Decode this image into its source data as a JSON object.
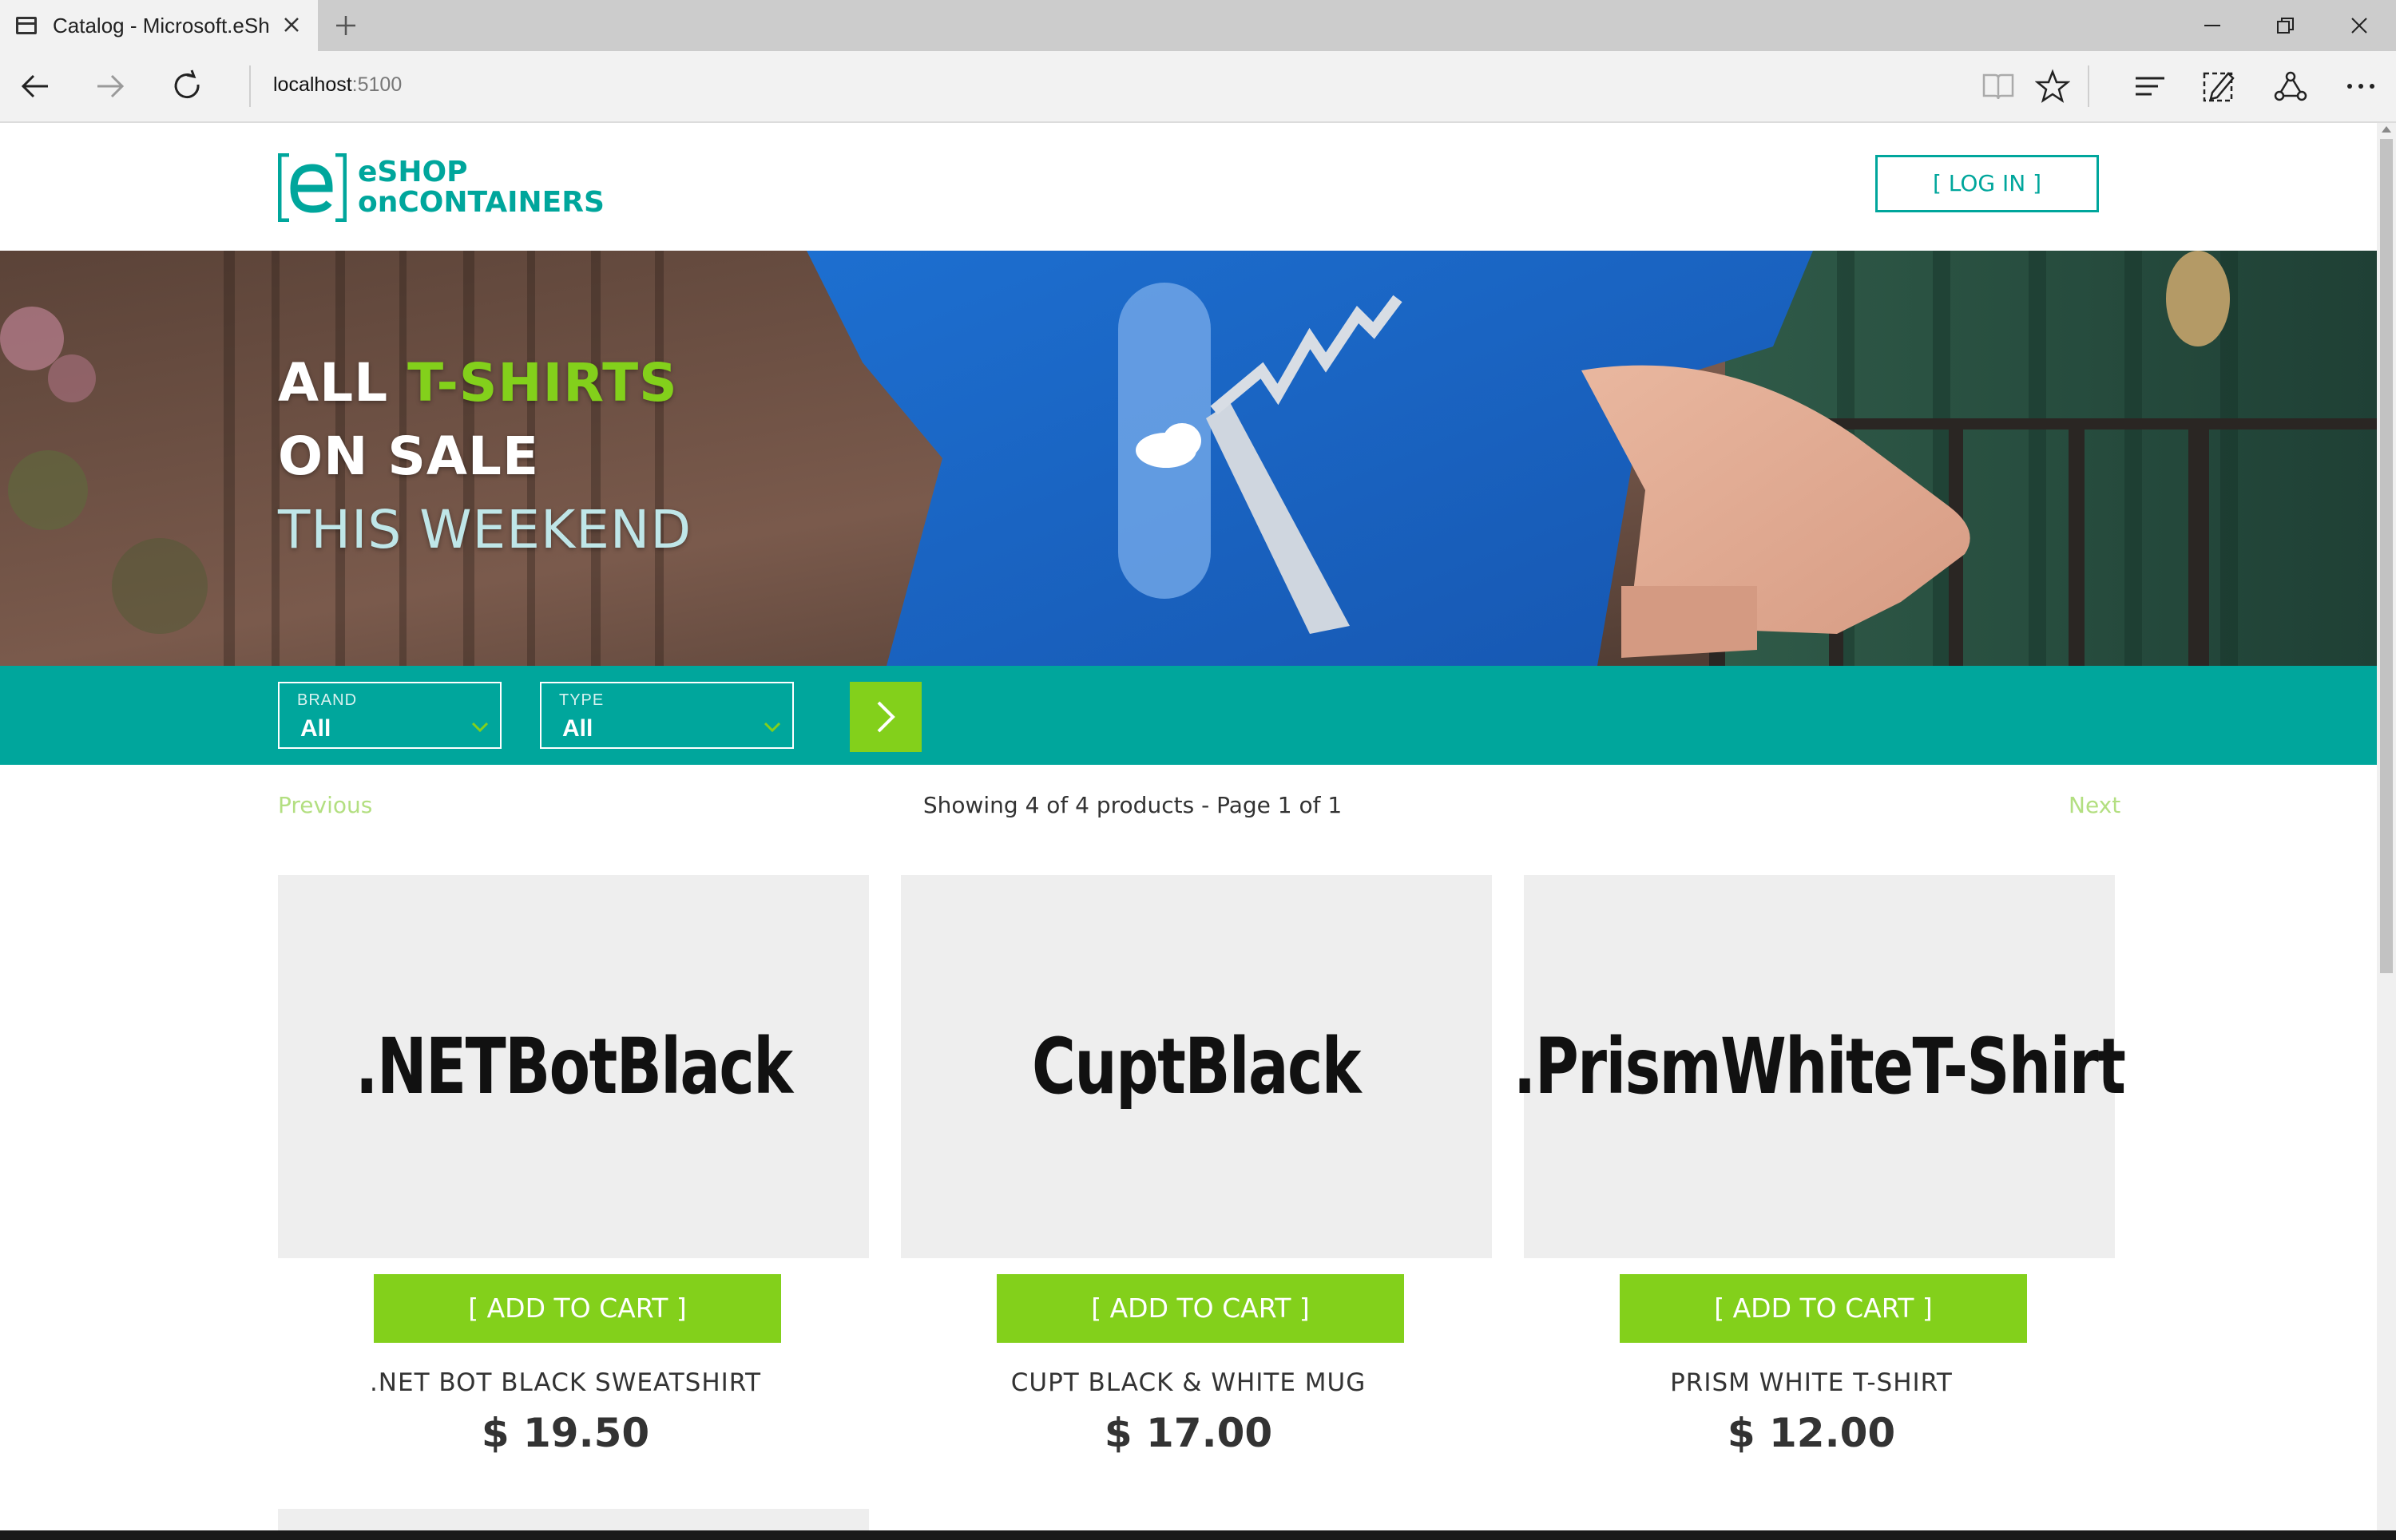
{
  "browser": {
    "tab_title": "Catalog - Microsoft.eSh",
    "address_host": "localhost",
    "address_port": ":5100"
  },
  "header": {
    "logo_line1": "eSHOP",
    "logo_line2": "onCONTAINERS",
    "login_label": "[ LOG IN ]"
  },
  "hero": {
    "line1_a": "ALL ",
    "line1_b": "T-SHIRTS",
    "line2": "ON SALE",
    "line3": "THIS WEEKEND"
  },
  "filters": {
    "brand_label": "BRAND",
    "brand_value": "All",
    "type_label": "TYPE",
    "type_value": "All"
  },
  "pager": {
    "previous": "Previous",
    "status": "Showing 4 of 4 products - Page 1 of 1",
    "next": "Next"
  },
  "products": [
    {
      "image_text": ".NETBotBlack",
      "add_label": "[ ADD TO CART ]",
      "name": ".NET BOT BLACK SWEATSHIRT",
      "price": "$ 19.50"
    },
    {
      "image_text": "CuptBlack",
      "add_label": "[ ADD TO CART ]",
      "name": "CUPT BLACK & WHITE MUG",
      "price": "$ 17.00"
    },
    {
      "image_text": ".PrismWhiteT-Shirt",
      "add_label": "[ ADD TO CART ]",
      "name": "PRISM WHITE T-SHIRT",
      "price": "$ 12.00"
    }
  ],
  "colors": {
    "brand_teal": "#00a69c",
    "accent_green": "#83d01b"
  },
  "icons": [
    "page-icon",
    "close-icon",
    "plus-icon",
    "minimize-icon",
    "restore-icon",
    "back-icon",
    "forward-icon",
    "refresh-icon",
    "reading-view-icon",
    "favorite-star-icon",
    "hub-icon",
    "web-note-icon",
    "share-icon",
    "more-icon",
    "chevron-down-icon",
    "chevron-right-icon"
  ]
}
